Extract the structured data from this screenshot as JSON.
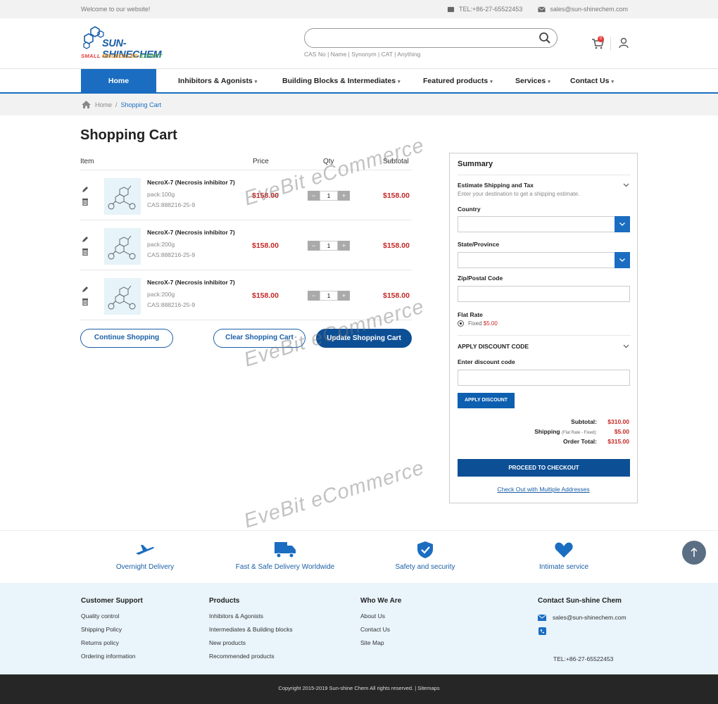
{
  "topbar": {
    "welcome": "Welcome to our website!",
    "tel": "TEL:+86-27-65522453",
    "email": "sales@sun-shinechem.com"
  },
  "logo": {
    "name": "SUN-SHINECHEM",
    "tagline": [
      "SMALL",
      " MOLECULES",
      " EXPERT",
      ""
    ]
  },
  "search": {
    "placeholder": "",
    "hint": "CAS No | Name | Synonym | CAT | Anything"
  },
  "cart_badge": "0",
  "nav": {
    "home": "Home",
    "items": [
      "Inhibitors & Agonists",
      "Building Blocks & Intermediates",
      "Featured products",
      "Services",
      "Contact Us"
    ]
  },
  "breadcrumb": {
    "home": "Home",
    "sep": "/",
    "current": "Shopping Cart"
  },
  "cart": {
    "title": "Shopping Cart",
    "headers": {
      "item": "Item",
      "price": "Price",
      "qty": "Qty",
      "subtotal": "Subtotal"
    },
    "rows": [
      {
        "name": "NecroX-7 (Necrosis inhibitor 7)",
        "pack": "pack:100g",
        "cas": "CAS:888216-25-9",
        "price": "$158.00",
        "qty": "1",
        "subtotal": "$158.00"
      },
      {
        "name": "NecroX-7 (Necrosis inhibitor 7)",
        "pack": "pack:200g",
        "cas": "CAS:888216-25-9",
        "price": "$158.00",
        "qty": "1",
        "subtotal": "$158.00"
      },
      {
        "name": "NecroX-7 (Necrosis inhibitor 7)",
        "pack": "pack:200g",
        "cas": "CAS:888216-25-9",
        "price": "$158.00",
        "qty": "1",
        "subtotal": "$158.00"
      }
    ],
    "buttons": {
      "continue": "Continue Shopping",
      "clear": "Clear Shopping Cart",
      "update": "Update Shopping Cart"
    }
  },
  "summary": {
    "title": "Summary",
    "estimate": "Estimate Shipping and Tax",
    "estimate_hint": "Enter your destination to get a shipping estimate.",
    "country": "Country",
    "state": "State/Province",
    "zip": "Zip/Postal Code",
    "flat_rate": "Flat Rate",
    "fixed_label": "Fixed",
    "fixed_price": "$5.00",
    "discount_heading": "APPLY DISCOUNT CODE",
    "discount_label": "Enter discount code",
    "apply_button": "APPLY DISCOUNT",
    "subtotal_label": "Subtotal:",
    "subtotal": "$310.00",
    "shipping_label": "Shipping",
    "shipping_note": "(Flat Rate - Fixed):",
    "shipping": "$5.00",
    "order_total_label": "Order Total:",
    "order_total": "$315.00",
    "checkout": "PROCEED TO CHECKOUT",
    "multi": "Check Out with Multiple Addresses"
  },
  "watermark": "EveBit eCommerce",
  "features": [
    "Overnight Delivery",
    "Fast & Safe Delivery Worldwide",
    "Safety and security",
    "Intimate service"
  ],
  "footer": {
    "support": {
      "title": "Customer Support",
      "links": [
        "Quality control",
        "Shipping Policy",
        "Returns policy",
        "Ordering information"
      ]
    },
    "products": {
      "title": "Products",
      "links": [
        "Inhibitors & Agonists",
        "Intermediates & Building blocks",
        "New products",
        "Recommended products"
      ]
    },
    "who": {
      "title": "Who We Are",
      "links": [
        "About Us",
        "Contact Us",
        "Site Map"
      ]
    },
    "contact": {
      "title": "Contact Sun-shine Chem",
      "email": "sales@sun-shinechem.com",
      "tel": "TEL:+86-27-65522453"
    },
    "copyright": "Copyright 2015-2019 Sun-shine Chem All rights reserved. | Sitemaps"
  },
  "colors": {
    "brand": "#1b6dc1",
    "dark_brand": "#0d4f95",
    "price": "#c62828"
  }
}
